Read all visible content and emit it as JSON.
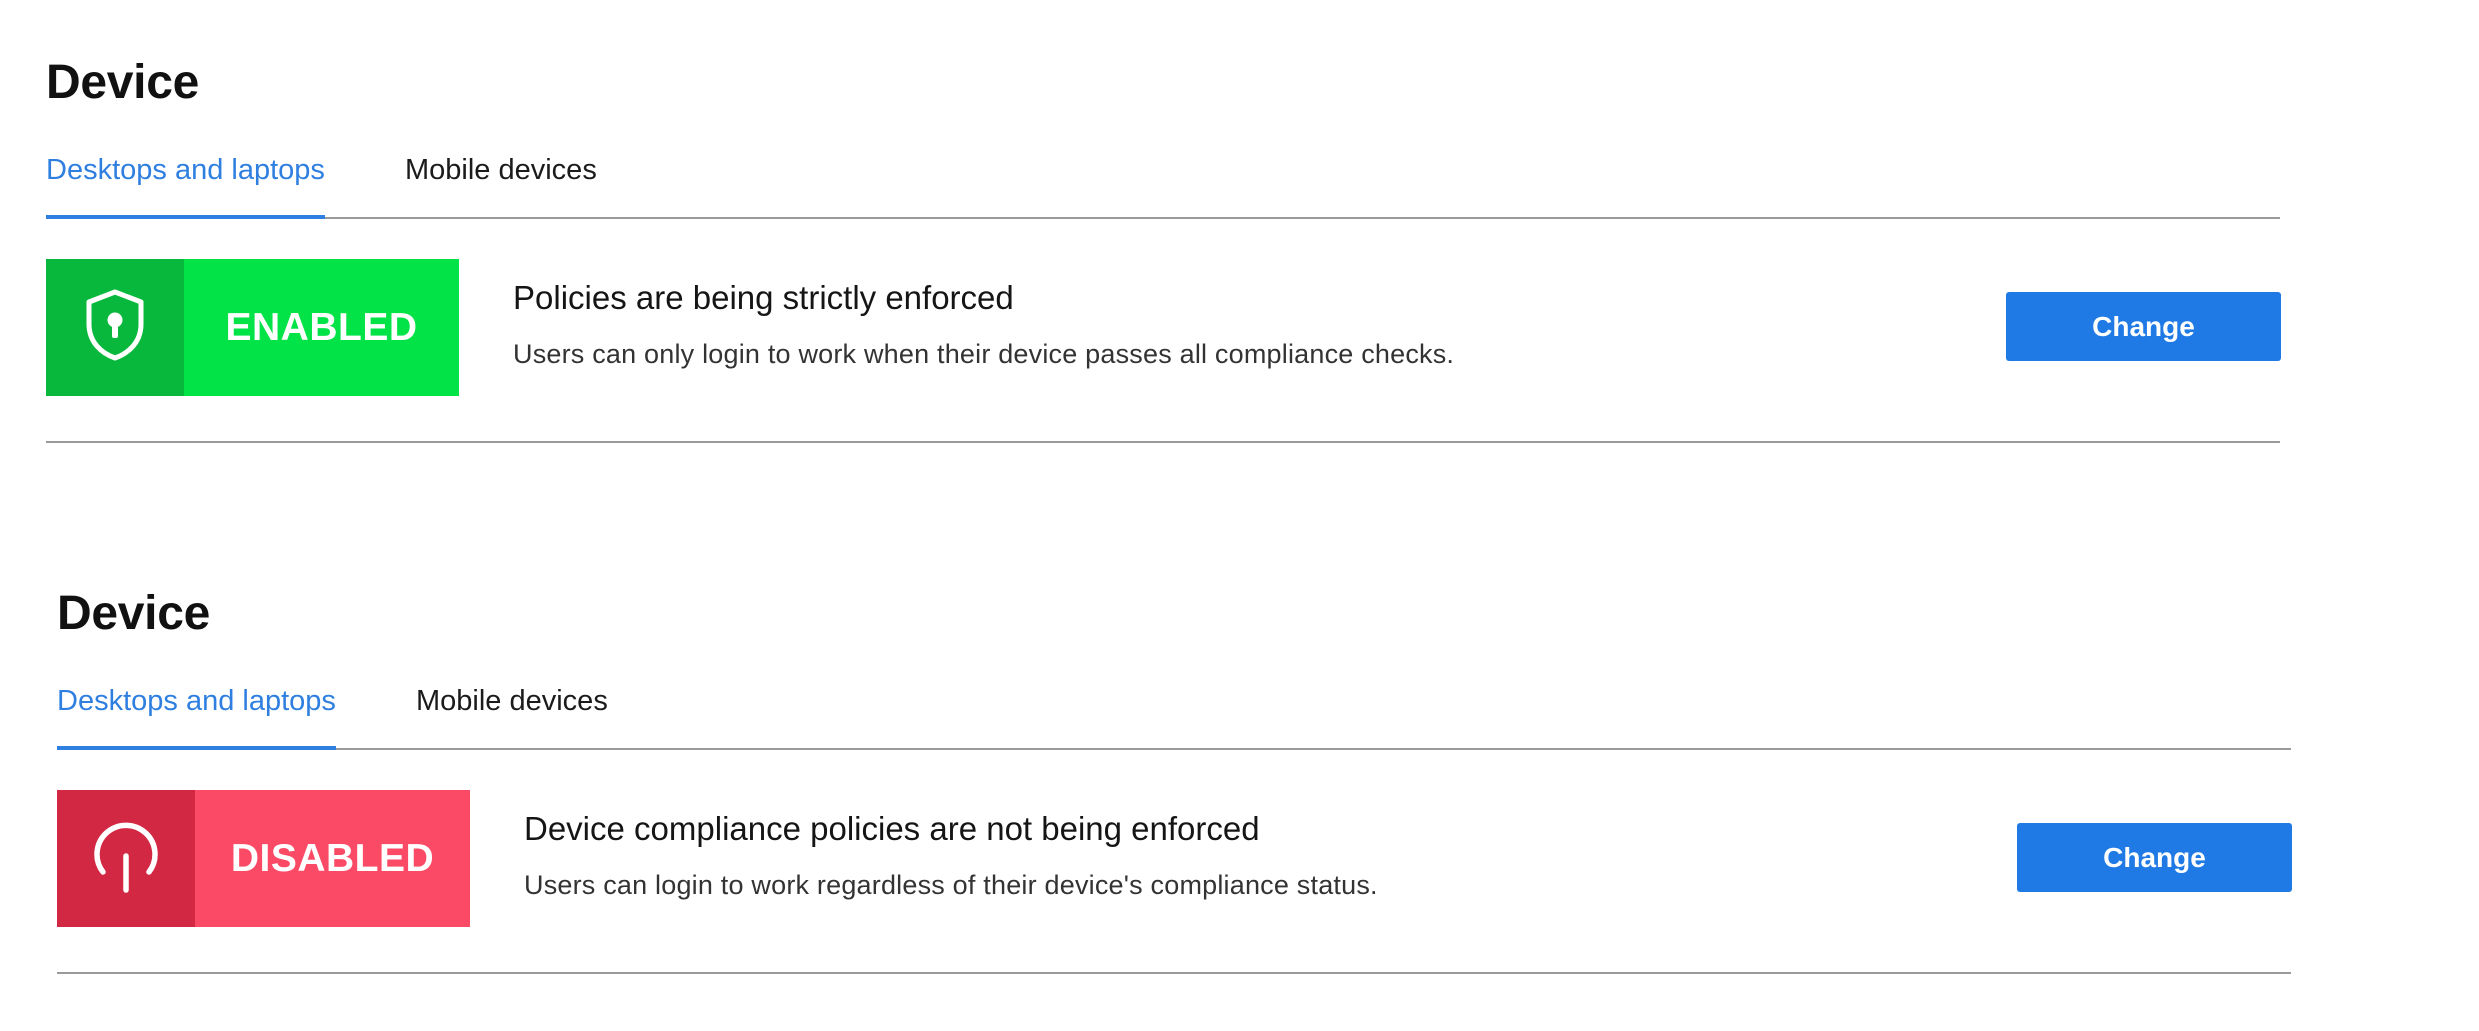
{
  "panels": [
    {
      "title": "Device",
      "tabs": [
        {
          "label": "Desktops and laptops",
          "active": true
        },
        {
          "label": "Mobile devices",
          "active": false
        }
      ],
      "status": {
        "state": "ENABLED",
        "icon": "shield-keyhole-icon",
        "heading": "Policies are being strictly enforced",
        "description": "Users can only login to work when their device passes all compliance checks.",
        "button_label": "Change",
        "colors": {
          "icon_bg": "#08b83c",
          "label_bg": "#01e346"
        }
      }
    },
    {
      "title": "Device",
      "tabs": [
        {
          "label": "Desktops and laptops",
          "active": true
        },
        {
          "label": "Mobile devices",
          "active": false
        }
      ],
      "status": {
        "state": "DISABLED",
        "icon": "power-icon",
        "heading": "Device compliance policies are not being enforced",
        "description": "Users can login to work regardless of their device's compliance status.",
        "button_label": "Change",
        "colors": {
          "icon_bg": "#d32844",
          "label_bg": "#fb4a66"
        }
      }
    }
  ],
  "accent_color": "#1f7ae5"
}
